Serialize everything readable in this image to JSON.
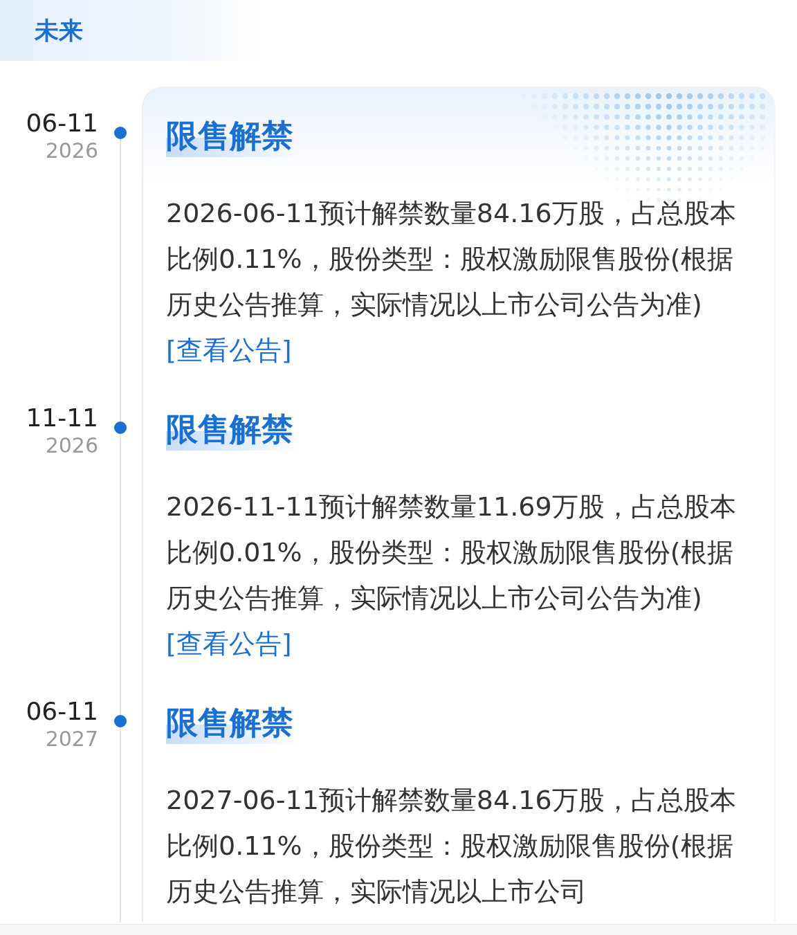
{
  "section_title": "未来",
  "events": [
    {
      "date": "06-11",
      "year": "2026",
      "title": "限售解禁",
      "description": "2026-06-11预计解禁数量84.16万股，占总股本比例0.11%，股份类型：股权激励限售股份(根据历史公告推算，实际情况以上市公司公告为准)",
      "link": "[查看公告]"
    },
    {
      "date": "11-11",
      "year": "2026",
      "title": "限售解禁",
      "description": "2026-11-11预计解禁数量11.69万股，占总股本比例0.01%，股份类型：股权激励限售股份(根据历史公告推算，实际情况以上市公司公告为准)",
      "link": "[查看公告]"
    },
    {
      "date": "06-11",
      "year": "2027",
      "title": "限售解禁",
      "description": "2027-06-11预计解禁数量84.16万股，占总股本比例0.11%，股份类型：股权激励限售股份(根据历史公告推算，实际情况以上市公司"
    }
  ]
}
